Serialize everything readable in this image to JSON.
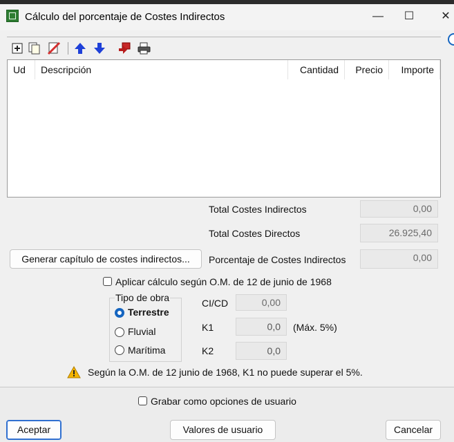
{
  "window": {
    "title": "Cálculo del porcentaje de Costes Indirectos",
    "minimize": "—",
    "maximize": "☐",
    "close": "✕"
  },
  "toolbar": {
    "icons": [
      "add-row-icon",
      "copy-icon",
      "delete-icon",
      "move-up-icon",
      "move-down-icon",
      "import-icon",
      "print-icon"
    ]
  },
  "grid": {
    "columns": [
      "Ud",
      "Descripción",
      "Cantidad",
      "Precio",
      "Importe"
    ],
    "rows": []
  },
  "totals": {
    "indirect_label": "Total Costes Indirectos",
    "indirect_value": "0,00",
    "direct_label": "Total Costes Directos",
    "direct_value": "26.925,40",
    "percent_label": "Porcentaje de Costes Indirectos",
    "percent_value": "0,00"
  },
  "generate_button": "Generar capítulo de costes indirectos...",
  "apply_om": {
    "label": "Aplicar cálculo según O.M. de 12 de junio de 1968",
    "checked": false
  },
  "tipo_obra": {
    "legend": "Tipo de obra",
    "options": [
      "Terrestre",
      "Fluvial",
      "Marítima"
    ],
    "selected": "Terrestre"
  },
  "params": {
    "ci_cd_label": "CI/CD",
    "ci_cd_value": "0,00",
    "k1_label": "K1",
    "k1_value": "0,0",
    "k1_hint": "(Máx. 5%)",
    "k2_label": "K2",
    "k2_value": "0,0"
  },
  "warning": "Según la O.M. de 12 junio de 1968, K1 no puede superar el 5%.",
  "save_user_options": {
    "label": "Grabar como opciones de usuario",
    "checked": false
  },
  "buttons": {
    "accept": "Aceptar",
    "user_values": "Valores de usuario",
    "cancel": "Cancelar"
  },
  "colors": {
    "accent": "#1565c0",
    "warning": "#f4b400"
  }
}
